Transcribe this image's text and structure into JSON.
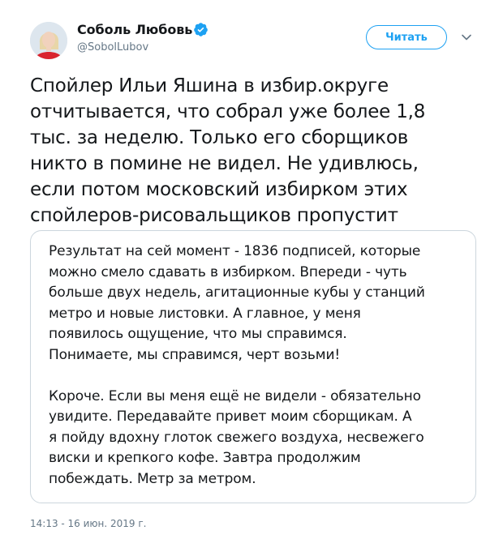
{
  "author": {
    "display_name": "Соболь Любовь",
    "handle": "@SobolLubov",
    "avatar_icon": "avatar-portrait",
    "verified_icon": "verified-badge-icon",
    "verified_color": "#1da1f2"
  },
  "actions": {
    "follow_label": "Читать",
    "menu_icon": "chevron-down-icon"
  },
  "tweet": {
    "text": "Спойлер Ильи Яшина в избир.округе\nотчитывается, что собрал уже более 1,8\nтыс. за неделю. Только его сборщиков\nникто в помине не видел. Не удивлюсь,\nесли потом московский избирком этих\nспойлеров-рисовальщиков пропустит",
    "quoted_text": "Результат на сей момент - 1836 подписей, которые\nможно смело сдавать в избирком. Впереди - чуть\nбольше двух недель, агитационные кубы у станций\nметро и новые листовки. А главное, у меня\nпоявилось ощущение, что мы справимся.\nПонимаете, мы справимся, черт возьми!\n\nКороче. Если вы меня ещё не видели - обязательно\nувидите. Передавайте привет моим сборщикам. А\nя пойду вдохну глоток свежего воздуха, несвежего\nвиски и крепкого кофе. Завтра продолжим\nпобеждать. Метр за метром.",
    "timestamp": "14:13 - 16 июн. 2019 г."
  },
  "colors": {
    "accent": "#1da1f2",
    "text": "#14171a",
    "muted": "#657786",
    "border": "#ccd6dd"
  }
}
